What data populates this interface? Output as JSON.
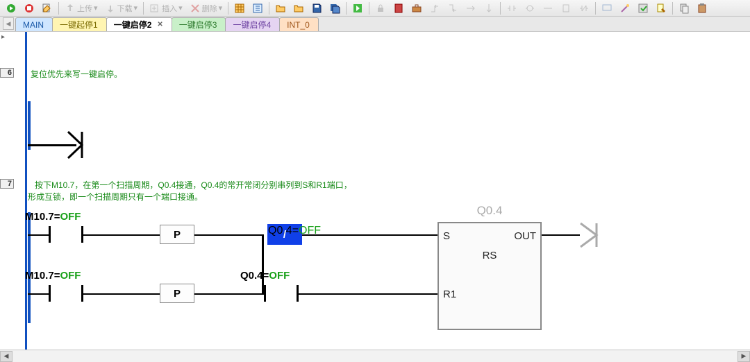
{
  "toolbar": {
    "upload": "上传",
    "download": "下载",
    "insert": "插入",
    "delete": "删除"
  },
  "tabs": {
    "main": "MAIN",
    "t1": "一键起停1",
    "t2": "一键启停2",
    "t3": "一键启停3",
    "t4": "一键启停4",
    "t5": "INT_0"
  },
  "expand_icon": "▸",
  "rungs": {
    "r6": {
      "num": "6",
      "comment": "复位优先来写一键启停。"
    },
    "r7": {
      "num": "7",
      "comment": "   按下M10.7，在第一个扫描周期，Q0.4接通，Q0.4的常开常闭分别串列到S和R1端口，\n形成互锁，即一个扫描周期只有一个端口接通。",
      "c1_addr": "M10.7=",
      "c1_state": "OFF",
      "c2_addr": "Q0.4=",
      "c2_state": "OFF",
      "p_label": "P",
      "slash_label": "/",
      "c3_addr": "M10.7=",
      "c3_state": "OFF",
      "c4_addr": "Q0.4=",
      "c4_state": "OFF",
      "fb_title": "Q0.4",
      "fb_name": "RS",
      "fb_s": "S",
      "fb_r1": "R1",
      "fb_out": "OUT"
    }
  }
}
